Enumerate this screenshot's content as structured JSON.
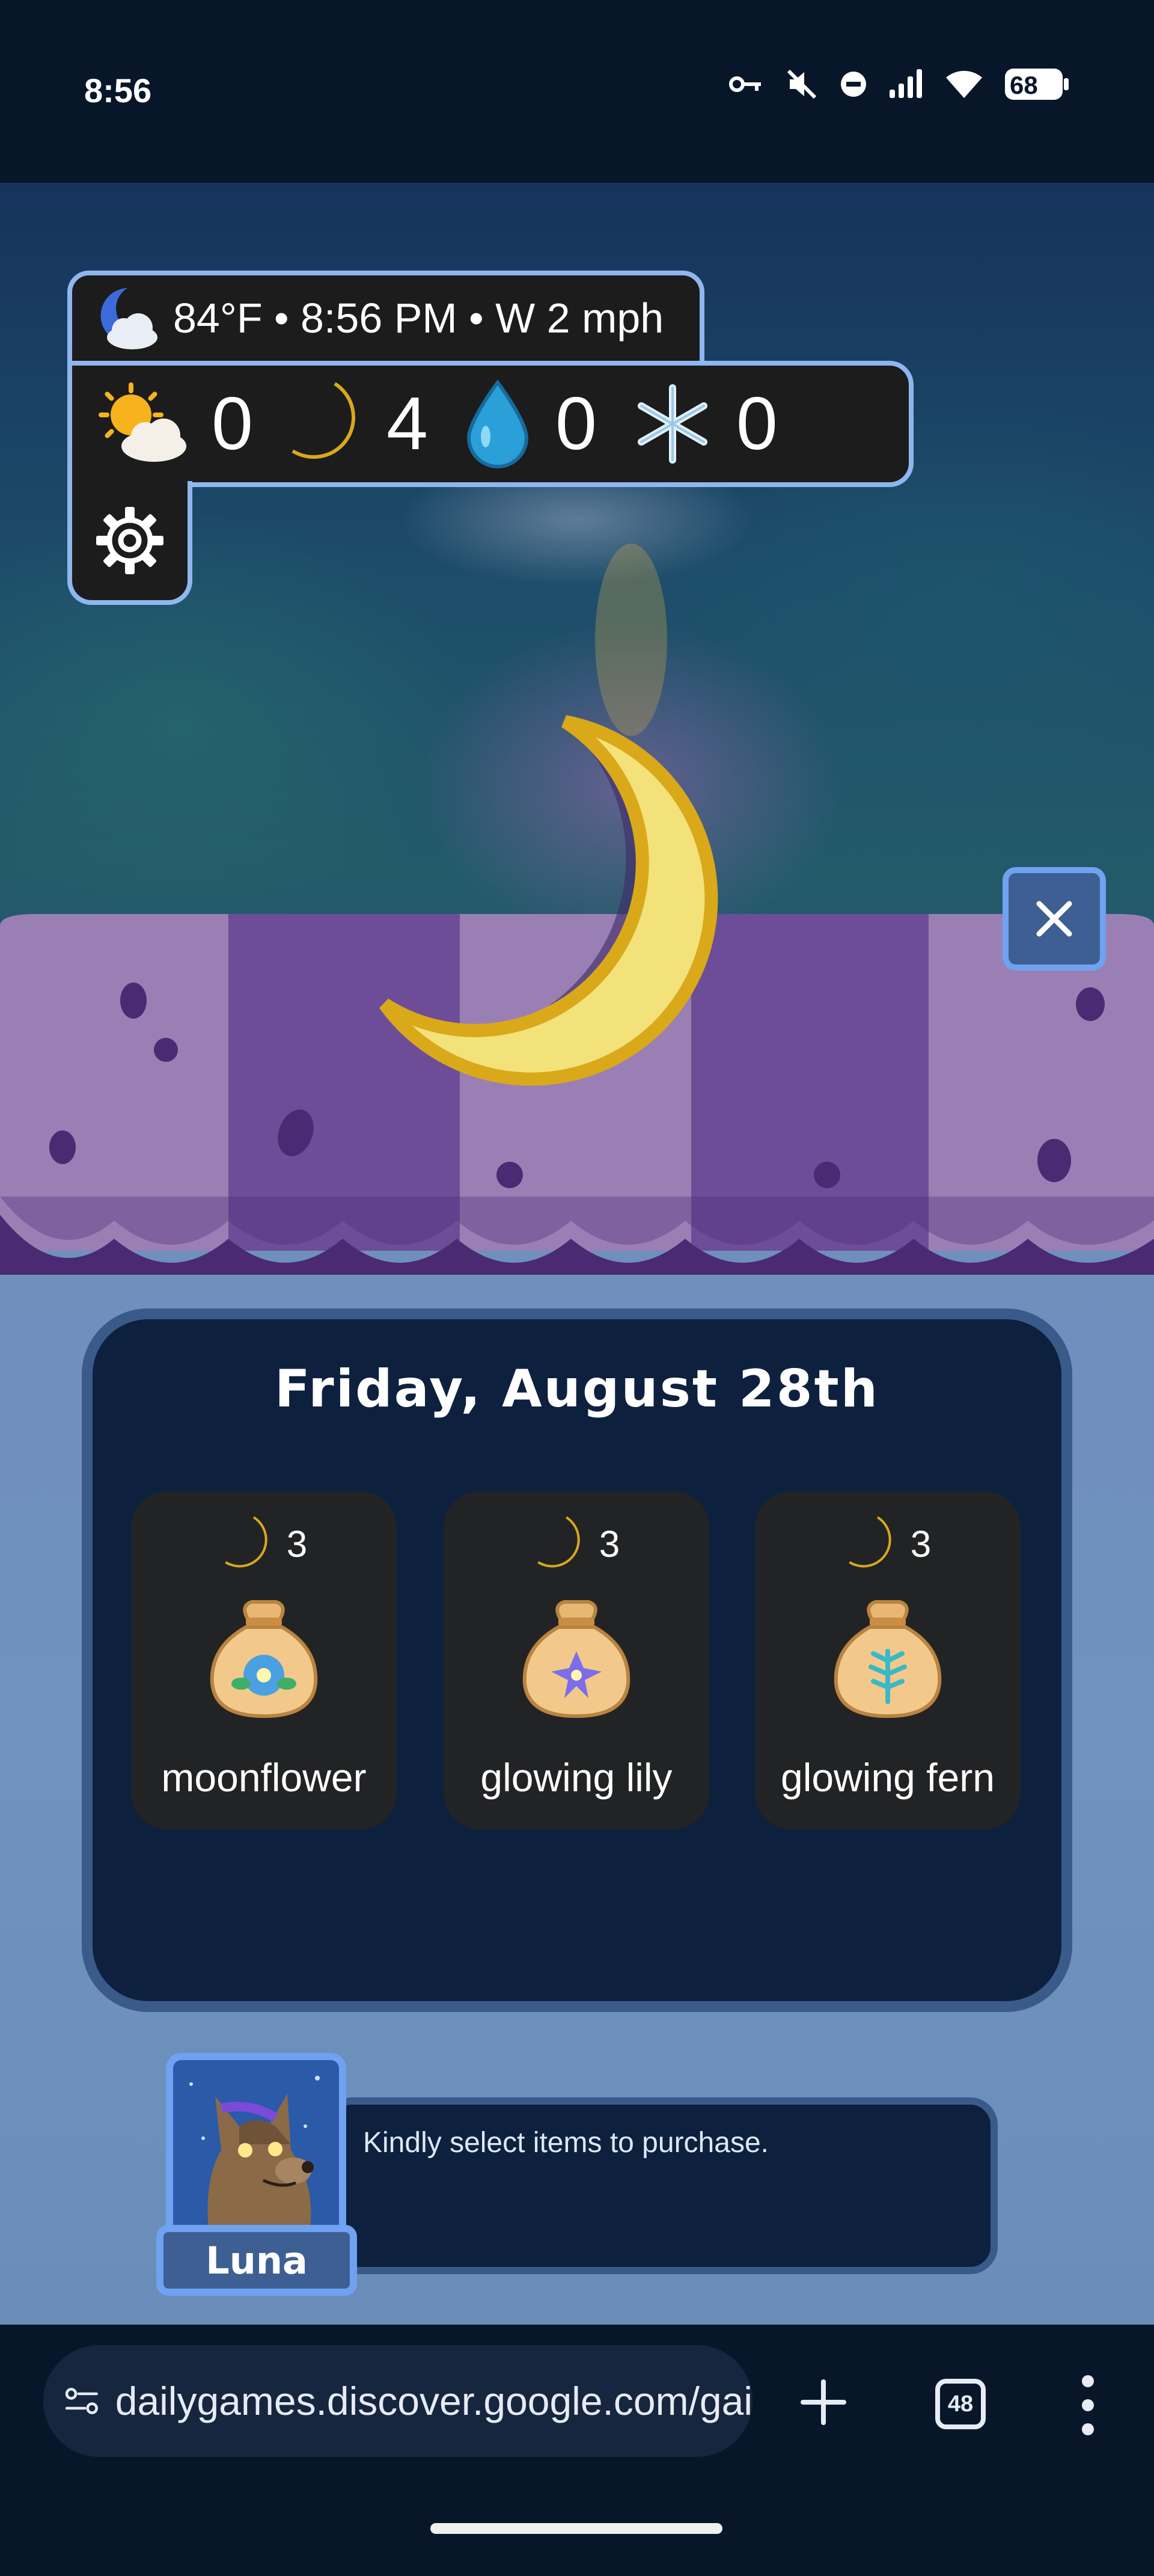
{
  "status_bar": {
    "time": "8:56",
    "battery": "68",
    "icons": [
      "key-icon",
      "mute-icon",
      "dnd-icon",
      "signal-icon",
      "wifi-icon",
      "battery-icon"
    ]
  },
  "hud": {
    "weather_text": "84°F • 8:56 PM • W 2 mph",
    "weather_icon": "moon-cloud-icon",
    "counts": [
      {
        "icon": "sun-cloud-icon",
        "value": "0"
      },
      {
        "icon": "moon-icon",
        "value": "4"
      },
      {
        "icon": "raindrop-icon",
        "value": "0"
      },
      {
        "icon": "snowflake-icon",
        "value": "0"
      }
    ],
    "settings_icon": "gear-icon"
  },
  "shop": {
    "date": "Friday, August 28th",
    "close_icon": "close-icon",
    "items": [
      {
        "name": "moonflower",
        "price": "3",
        "currency_icon": "moon-icon",
        "seed_color": "#4aa0e0"
      },
      {
        "name": "glowing lily",
        "price": "3",
        "currency_icon": "moon-icon",
        "seed_color": "#7b6ee8"
      },
      {
        "name": "glowing fern",
        "price": "3",
        "currency_icon": "moon-icon",
        "seed_color": "#3bb8c8"
      }
    ]
  },
  "dialogue": {
    "speaker": "Luna",
    "text": "Kindly select items to purchase."
  },
  "browser": {
    "url": "dailygames.discover.google.com/gai",
    "tab_count": "48"
  },
  "colors": {
    "accent": "#8fb6ee",
    "panel": "#0d213f",
    "moon": "#f2d04a",
    "awning_light": "#9a7fb5",
    "awning_dark": "#6d4d98"
  }
}
